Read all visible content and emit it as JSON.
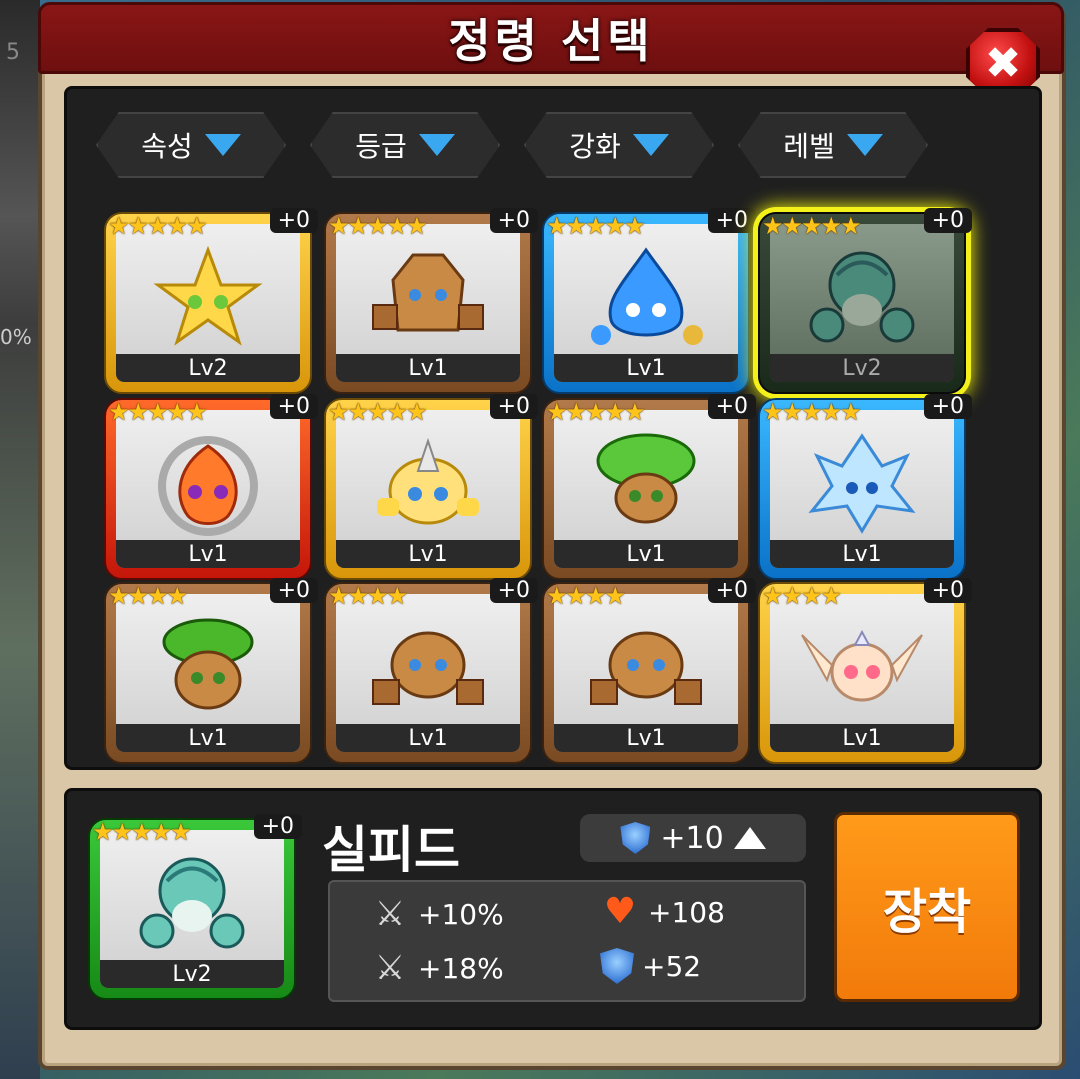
{
  "title": "정령 선택",
  "close_label": "✖",
  "filters": [
    {
      "label": "속성"
    },
    {
      "label": "등급"
    },
    {
      "label": "강화"
    },
    {
      "label": "레벨"
    }
  ],
  "cards": [
    {
      "level": "Lv2",
      "plus": "+0",
      "stars": "★★★★★",
      "frame": "gold",
      "spirit": "light-star"
    },
    {
      "level": "Lv1",
      "plus": "+0",
      "stars": "★★★★★",
      "frame": "brown",
      "spirit": "rock-golem"
    },
    {
      "level": "Lv1",
      "plus": "+0",
      "stars": "★★★★★",
      "frame": "blue",
      "spirit": "water-drop"
    },
    {
      "level": "Lv2",
      "plus": "+0",
      "stars": "★★★★★",
      "frame": "dark-selected",
      "spirit": "wind-sylph"
    },
    {
      "level": "Lv1",
      "plus": "+0",
      "stars": "★★★★★",
      "frame": "red",
      "spirit": "fire-spike"
    },
    {
      "level": "Lv1",
      "plus": "+0",
      "stars": "★★★★★",
      "frame": "gold",
      "spirit": "light-knight"
    },
    {
      "level": "Lv1",
      "plus": "+0",
      "stars": "★★★★★",
      "frame": "brown",
      "spirit": "tree-sprout"
    },
    {
      "level": "Lv1",
      "plus": "+0",
      "stars": "★★★★★",
      "frame": "blue",
      "spirit": "ice-crystal"
    },
    {
      "level": "Lv1",
      "plus": "+0",
      "stars": "★★★★",
      "frame": "brown",
      "spirit": "leaf-dryad"
    },
    {
      "level": "Lv1",
      "plus": "+0",
      "stars": "★★★★",
      "frame": "brown",
      "spirit": "rock-golem"
    },
    {
      "level": "Lv1",
      "plus": "+0",
      "stars": "★★★★",
      "frame": "brown",
      "spirit": "rock-golem"
    },
    {
      "level": "Lv1",
      "plus": "+0",
      "stars": "★★★★",
      "frame": "gold",
      "spirit": "angel-wing"
    }
  ],
  "selected": {
    "name": "실피드",
    "level": "Lv2",
    "plus": "+0",
    "stars": "★★★★★",
    "enhance": "+10",
    "stats": {
      "attack1": "+10%",
      "hp": "+108",
      "attack2": "+18%",
      "defense": "+52"
    }
  },
  "equip_label": "장착",
  "colors": {
    "title_bar": "#7a1212",
    "equip": "#f7880f",
    "filter_arrow": "#3aa8f0",
    "stars": "#ffc41a"
  }
}
